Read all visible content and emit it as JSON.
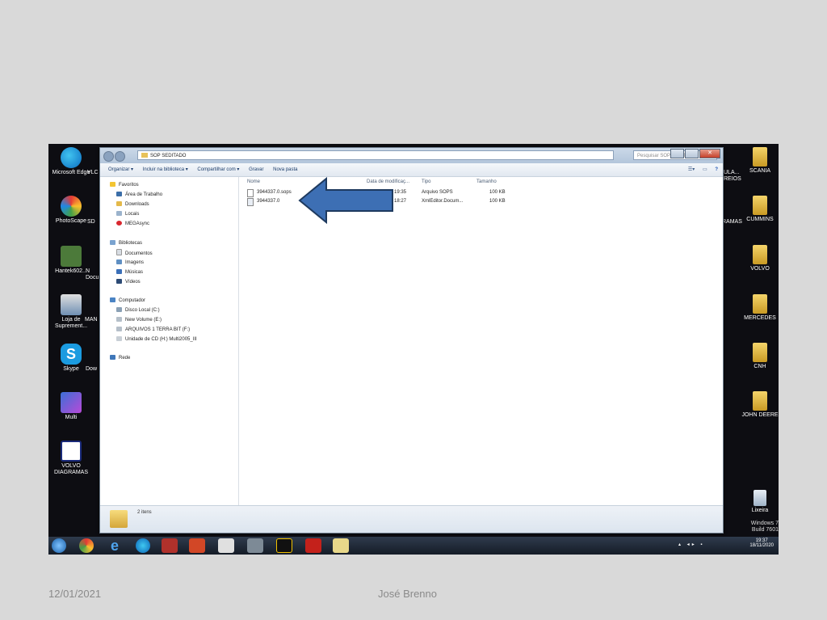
{
  "explorer": {
    "address": "SOP SEDITADO",
    "search_placeholder": "Pesquisar SOP SEDITADO",
    "toolbar": [
      "Organizar ▾",
      "Incluir na biblioteca ▾",
      "Compartilhar com ▾",
      "Gravar",
      "Nova pasta"
    ],
    "nav": {
      "favorites_header": "Favoritos",
      "favorites": [
        "Área de Trabalho",
        "Downloads",
        "Locais",
        "MEGAsync"
      ],
      "libraries_header": "Bibliotecas",
      "libraries": [
        "Documentos",
        "Imagens",
        "Músicas",
        "Vídeos"
      ],
      "computer_header": "Computador",
      "drives": [
        "Disco Local (C:)",
        "New Volume (E:)",
        "ARQUIVOS 1 TERRA BIT (F:)",
        "Unidade de CD (H:) Multi2005_III"
      ],
      "network": "Rede"
    },
    "columns": [
      "Nome",
      "Data de modificaç...",
      "Tipo",
      "Tamanho"
    ],
    "files": [
      {
        "name": "3944337.0.sops",
        "date": "19:35",
        "type": "Arquivo SOPS",
        "size": "100 KB"
      },
      {
        "name": "3944337.0",
        "date": "18:27",
        "type": "XmlEditor.Docum...",
        "size": "100 KB"
      }
    ],
    "status_count": "2 itens"
  },
  "desktop": {
    "left_icons": [
      "Microsoft Edge",
      "PhotoScape",
      "Hantek602...",
      "Loja de Suprement...",
      "Skype",
      "Multi",
      "VOLVO DIAGRAMAS"
    ],
    "left_partial": [
      "VLC pl",
      "SD",
      "N Docu",
      "MAN",
      "Dow"
    ],
    "right_icons": [
      "SCANIA",
      "CUMMINS",
      "VOLVO",
      "MERCEDES",
      "CNH",
      "JOHN DEERE"
    ],
    "right_partial": [
      "ULA... REIOS",
      "RAMAS"
    ],
    "recycle": "Lixeira",
    "watermark": [
      "Windows 7",
      "Build 7601"
    ]
  },
  "taskbar": {
    "time": "19:37",
    "date": "18/11/2020"
  },
  "footer": {
    "date": "12/01/2021",
    "author": "José Brenno"
  },
  "colors": {
    "arrow": "#3d6fb4",
    "arrow_outline": "#1e3a5f",
    "slide_bg": "#d9d9d9"
  }
}
